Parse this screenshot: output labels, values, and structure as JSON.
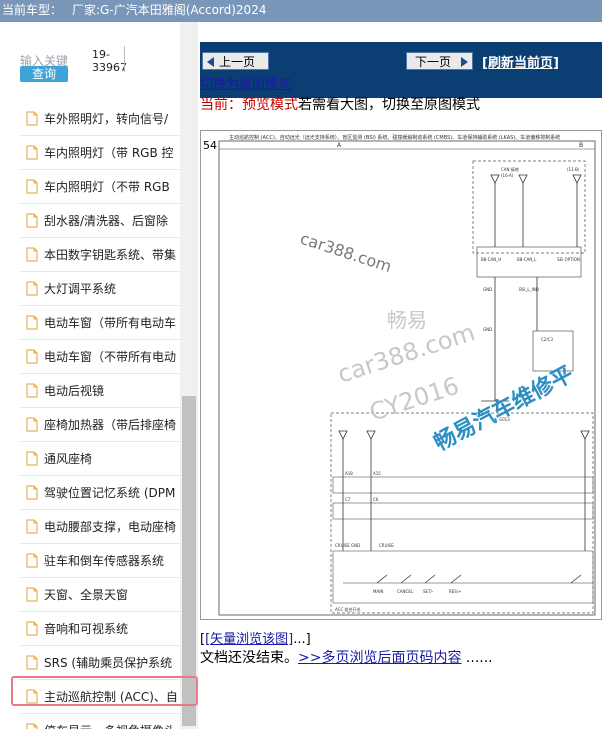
{
  "header": {
    "car_type_label": "当前车型：",
    "manufacturer": "厂家:G-广汽本田雅阁(Accord)2024"
  },
  "search": {
    "label": "输入关键",
    "button": "查询",
    "code_line1": "19-",
    "code_line2": "33967"
  },
  "sidebar": {
    "items": [
      {
        "label": "车外照明灯，转向信号/"
      },
      {
        "label": "车内照明灯（带 RGB 控"
      },
      {
        "label": "车内照明灯（不带 RGB"
      },
      {
        "label": "刮水器/清洗器、后窗除"
      },
      {
        "label": "本田数字钥匙系统、带集"
      },
      {
        "label": "大灯调平系统"
      },
      {
        "label": "电动车窗（带所有电动车"
      },
      {
        "label": "电动车窗（不带所有电动"
      },
      {
        "label": "电动后视镜"
      },
      {
        "label": "座椅加热器（带后排座椅"
      },
      {
        "label": "通风座椅"
      },
      {
        "label": "驾驶位置记忆系统 (DPM"
      },
      {
        "label": "电动腰部支撑，电动座椅"
      },
      {
        "label": "驻车和倒车传感器系统"
      },
      {
        "label": "天窗、全景天窗"
      },
      {
        "label": "音响和可视系统"
      },
      {
        "label": "SRS (辅助乘员保护系统"
      },
      {
        "label": "主动巡航控制 (ACC)、自"
      },
      {
        "label": "停车显示，多视角摄像头"
      }
    ],
    "selected_index": 17
  },
  "nav": {
    "prev_label": "上一页",
    "next_label": "下一页",
    "refresh_label": "[刷新当前页]"
  },
  "content": {
    "switch_link": "切换为原图模式",
    "mode_prefix": "当前：预览模式",
    "mode_suffix": "若需看大图，切换至原图模式",
    "vector_link": "[矢量浏览该图]",
    "doc_not_end": "文档还没结束。",
    "more_pages_link": ">>多页浏览后面页码内容",
    "ellipsis": "......"
  },
  "diagram": {
    "page_number": "54",
    "title": "主动巡航控制 (ACC)、自动远光（远光支持系统）、盲区监测 (BSI) 系统、碰撞缓解制动系统 (CMBS)、车道保持辅助系统 (LKAS)、车道偏移抑制系统",
    "col_a": "A",
    "col_b": "B",
    "labels": [
      "CAN 接地",
      "(16-A)",
      "(11-B)",
      "B8-CAN_H",
      "B8-CAN_L",
      "SEI OPTION",
      "GND",
      "BSI_L_IND",
      "C2/C3",
      "GND",
      "G013",
      "CRUISE GND",
      "CRUISE",
      "MAIN",
      "CANCEL",
      "SET/-",
      "RES/+",
      "ACC 组合开关",
      "A18",
      "A15",
      "C7",
      "C6"
    ],
    "watermarks": [
      "car388.com",
      "畅易",
      "car388.com",
      "CY2016",
      "畅易汽车维修平"
    ]
  },
  "colors": {
    "topbar": "#7a96b8",
    "navbar": "#0b3f73",
    "search_button": "#3ea3d7",
    "highlight": "#e7798a",
    "mode_red": "#c00000",
    "link": "#1a1aa6"
  }
}
